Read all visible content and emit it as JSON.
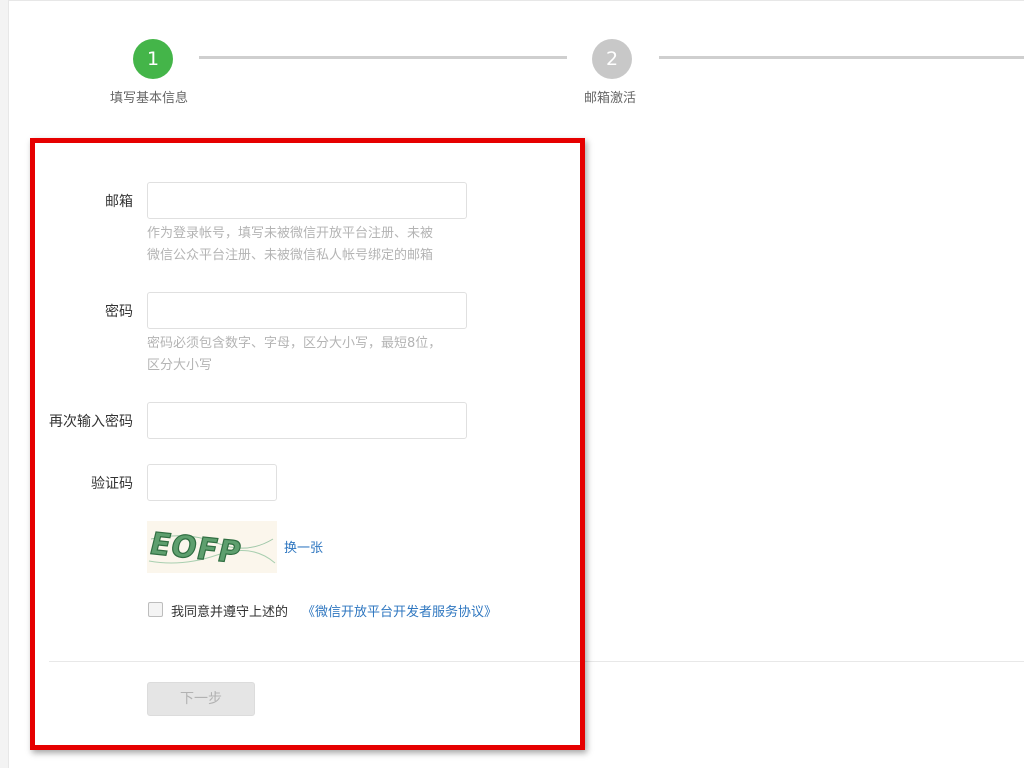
{
  "steps": [
    {
      "number": "1",
      "label": "填写基本信息",
      "state": "active"
    },
    {
      "number": "2",
      "label": "邮箱激活",
      "state": "inactive"
    }
  ],
  "form": {
    "email": {
      "label": "邮箱",
      "value": "",
      "hint_line1": "作为登录帐号，填写未被微信开放平台注册、未被",
      "hint_line2": "微信公众平台注册、未被微信私人帐号绑定的邮箱"
    },
    "password": {
      "label": "密码",
      "value": "",
      "hint_line1": "密码必须包含数字、字母，区分大小写，最短8位，",
      "hint_line2": "区分大小写"
    },
    "confirm_password": {
      "label": "再次输入密码",
      "value": ""
    },
    "captcha": {
      "label": "验证码",
      "value": "",
      "image_text": "EOFP",
      "refresh_label": "换一张"
    },
    "agreement": {
      "text": "我同意并遵守上述的",
      "link": "《微信开放平台开发者服务协议》",
      "checked": false
    },
    "next_button": "下一步"
  },
  "colors": {
    "active_step": "#44b549",
    "inactive_step": "#c8c8c8",
    "link": "#2f77c0",
    "highlight": "#e60000"
  }
}
